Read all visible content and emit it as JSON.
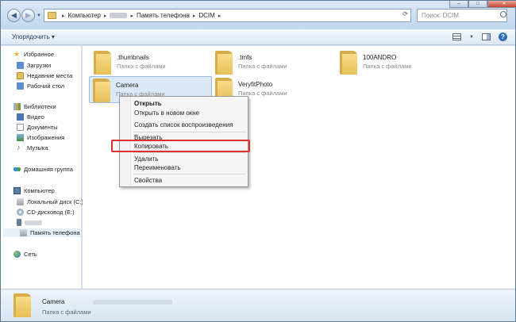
{
  "address": {
    "crumbs": [
      "Компьютер",
      "Память телефона",
      "DCIM"
    ]
  },
  "search": {
    "placeholder": "Поиск: DCIM"
  },
  "toolbar": {
    "organize_label": "Упорядочить"
  },
  "sidebar": {
    "favorites_header": "Избранное",
    "favorites": [
      "Загрузки",
      "Недавние места",
      "Рабочий стол"
    ],
    "libraries_header": "Библиотеки",
    "libraries": [
      "Видео",
      "Документы",
      "Изображения",
      "Музыка"
    ],
    "homegroup": "Домашняя группа",
    "computer_header": "Компьютер",
    "computer": [
      "Локальный диск (C:)",
      "CD-дисковод (E:)",
      "Память телефона"
    ],
    "network": "Сеть"
  },
  "folders": [
    {
      "name": ".thumbnails",
      "type": "Папка с файлами"
    },
    {
      "name": ".tmfs",
      "type": "Папка с файлами"
    },
    {
      "name": "100ANDRO",
      "type": "Папка с файлами"
    },
    {
      "name": "Camera",
      "type": "Папка с файлами",
      "selected": true
    },
    {
      "name": "VeryfitPhoto",
      "type": "Папка с файлами"
    }
  ],
  "context_menu": {
    "items": [
      "Открыть",
      "Открыть в новом окне",
      "Создать список воспроизведения",
      "Вырезать",
      "Копировать",
      "Удалить",
      "Переименовать",
      "Свойства"
    ],
    "default_item": "Открыть",
    "highlighted_item": "Копировать",
    "highlight_color": "#e0322d"
  },
  "details": {
    "name": "Camera",
    "type": "Папка с файлами"
  },
  "icons": {
    "back": "back-arrow-icon",
    "forward": "forward-arrow-icon",
    "search": "search-icon",
    "folder": "folder-icon"
  }
}
